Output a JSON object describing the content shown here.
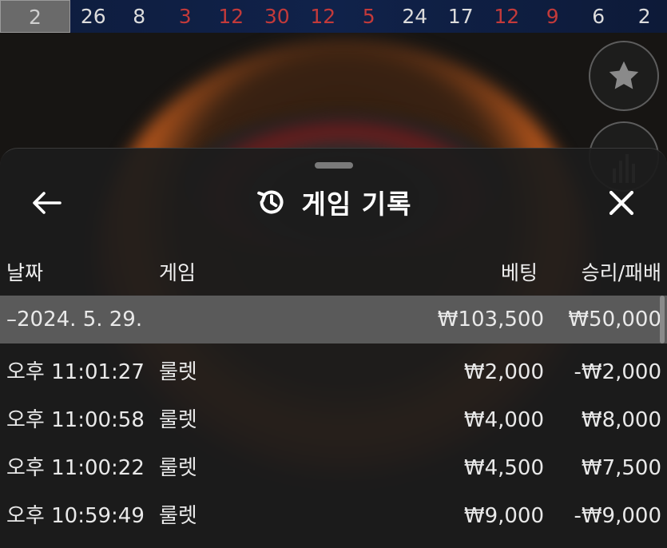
{
  "results_strip": {
    "current": "2",
    "numbers": [
      {
        "value": "26",
        "color": "white"
      },
      {
        "value": "8",
        "color": "white"
      },
      {
        "value": "3",
        "color": "red"
      },
      {
        "value": "12",
        "color": "red"
      },
      {
        "value": "30",
        "color": "red"
      },
      {
        "value": "12",
        "color": "red"
      },
      {
        "value": "5",
        "color": "red"
      },
      {
        "value": "24",
        "color": "white"
      },
      {
        "value": "17",
        "color": "white"
      },
      {
        "value": "12",
        "color": "red"
      },
      {
        "value": "9",
        "color": "red"
      },
      {
        "value": "6",
        "color": "white"
      },
      {
        "value": "2",
        "color": "white"
      }
    ]
  },
  "sheet": {
    "title": "게임 기록",
    "headers": {
      "date": "날짜",
      "game": "게임",
      "bet": "베팅",
      "win_loss": "승리/패배"
    },
    "summary": {
      "date": "–2024. 5. 29.",
      "bet": "₩103,500",
      "win_loss": "₩50,000"
    },
    "rows": [
      {
        "time": "오후 11:01:27",
        "game": "룰렛",
        "bet": "₩2,000",
        "win_loss": "-₩2,000"
      },
      {
        "time": "오후 11:00:58",
        "game": "룰렛",
        "bet": "₩4,000",
        "win_loss": "₩8,000"
      },
      {
        "time": "오후 11:00:22",
        "game": "룰렛",
        "bet": "₩4,500",
        "win_loss": "₩7,500"
      },
      {
        "time": "오후 10:59:49",
        "game": "룰렛",
        "bet": "₩9,000",
        "win_loss": "-₩9,000"
      }
    ]
  },
  "colors": {
    "red_number": "#c33a3a",
    "sheet_bg": "#1c1c1c",
    "summary_bg": "#5a5a5a"
  }
}
